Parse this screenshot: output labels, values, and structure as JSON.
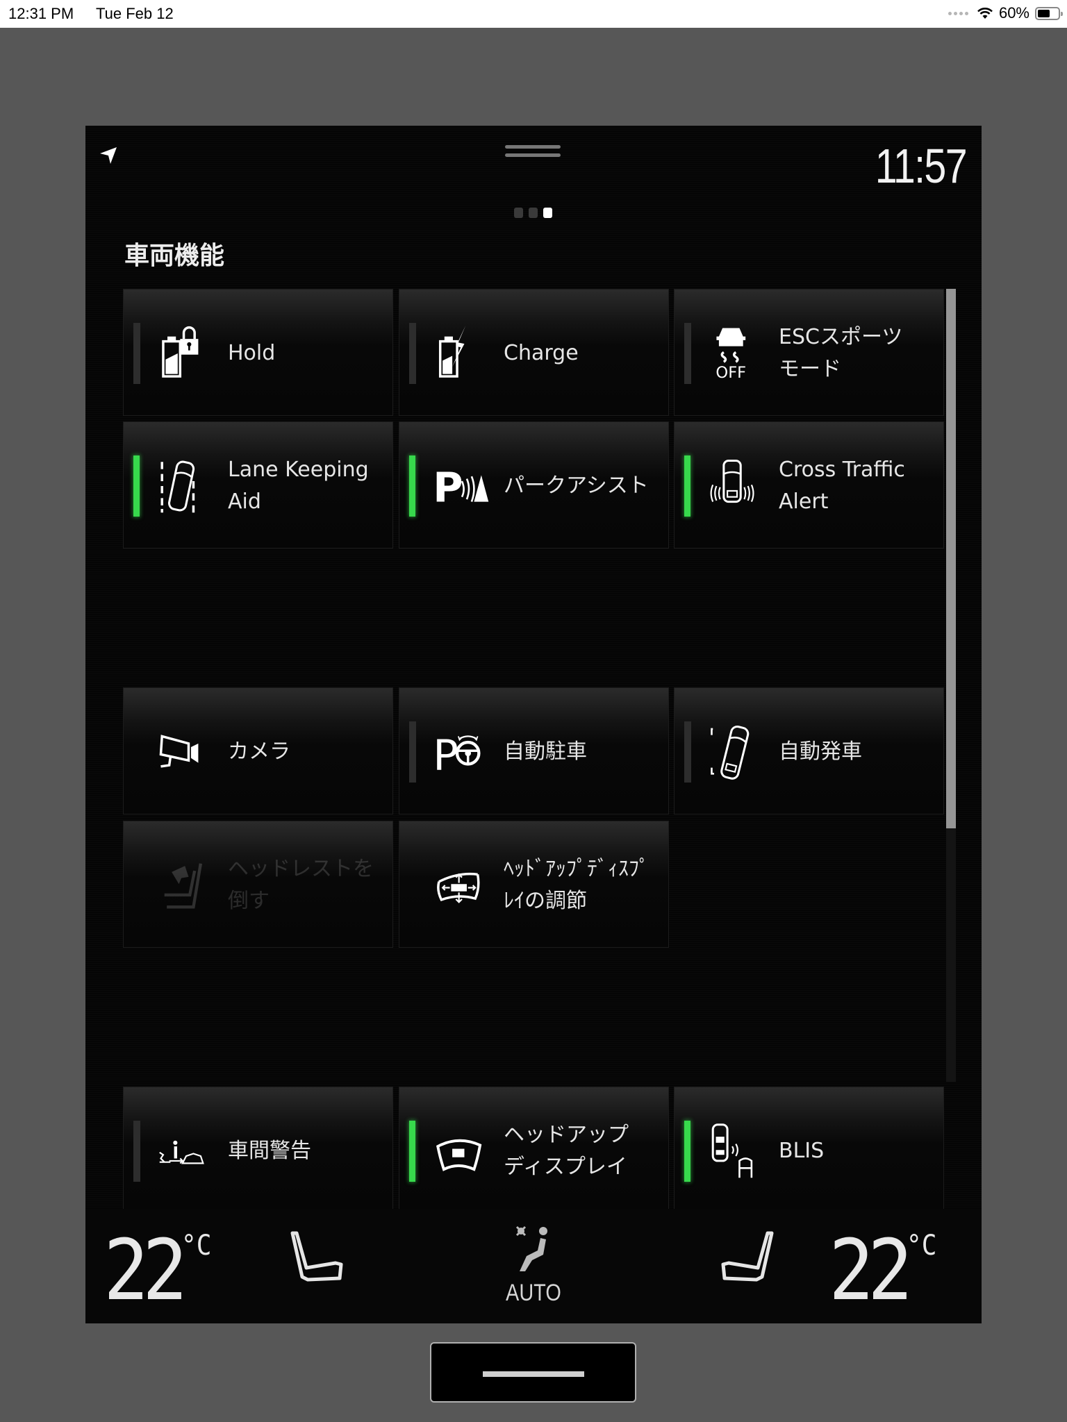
{
  "status_bar": {
    "time": "12:31 PM",
    "date": "Tue Feb 12",
    "battery_percent_label": "60%",
    "battery_level": 0.6,
    "wifi_icon": "wifi-icon"
  },
  "screen": {
    "clock": "11:57",
    "nav_icon": "navigation-arrow-icon",
    "page_indicator": {
      "total": 3,
      "active": 3
    },
    "section_title": "車両機能",
    "scroll_thumb_fraction": 0.68,
    "accent_on_color": "#37d94c",
    "tiles": [
      {
        "id": "hold",
        "lines": [
          "Hold"
        ],
        "icon": "battery-lock-icon",
        "indicator": "off",
        "enabled": true
      },
      {
        "id": "charge",
        "lines": [
          "Charge"
        ],
        "icon": "battery-charge-icon",
        "indicator": "off",
        "enabled": true
      },
      {
        "id": "esc-sport",
        "lines": [
          "ESCスポーツ",
          "モード"
        ],
        "icon": "esc-off-icon",
        "indicator": "off",
        "enabled": true
      },
      {
        "id": "lane-keeping",
        "lines": [
          "Lane Keeping",
          "Aid"
        ],
        "icon": "lane-keeping-icon",
        "indicator": "on",
        "enabled": true
      },
      {
        "id": "park-assist",
        "lines": [
          "パークアシスト"
        ],
        "icon": "park-assist-icon",
        "indicator": "on",
        "enabled": true
      },
      {
        "id": "cross-traffic",
        "lines": [
          "Cross Traffic",
          "Alert"
        ],
        "icon": "cross-traffic-icon",
        "indicator": "on",
        "enabled": true
      },
      {
        "id": "camera",
        "lines": [
          "カメラ"
        ],
        "icon": "camera-icon",
        "indicator": "none",
        "enabled": true
      },
      {
        "id": "auto-park",
        "lines": [
          "自動駐車"
        ],
        "icon": "park-steering-icon",
        "indicator": "off",
        "enabled": true
      },
      {
        "id": "auto-start",
        "lines": [
          "自動発車"
        ],
        "icon": "car-start-icon",
        "indicator": "off",
        "enabled": true
      },
      {
        "id": "headrest",
        "lines": [
          "ヘッドレストを",
          "倒す"
        ],
        "icon": "headrest-fold-icon",
        "indicator": "none",
        "enabled": false
      },
      {
        "id": "hud-adjust",
        "lines": [
          "ﾍｯﾄﾞｱｯﾌﾟﾃﾞｨｽﾌﾟ",
          "ﾚｲの調節"
        ],
        "icon": "hud-adjust-icon",
        "indicator": "none",
        "enabled": true
      },
      {
        "id": "distance-alert",
        "lines": [
          "車間警告"
        ],
        "icon": "distance-alert-icon",
        "indicator": "off",
        "enabled": true
      },
      {
        "id": "hud",
        "lines": [
          "ヘッドアップ",
          "ディスプレイ"
        ],
        "icon": "hud-icon",
        "indicator": "on",
        "enabled": true
      },
      {
        "id": "blis",
        "lines": [
          "BLIS"
        ],
        "icon": "blis-icon",
        "indicator": "on",
        "enabled": true
      }
    ]
  },
  "climate": {
    "left_temp": "22",
    "right_temp": "22",
    "unit": "°C",
    "fan_mode": "AUTO",
    "left_seat_icon": "seat-left-icon",
    "right_seat_icon": "seat-right-icon",
    "fan_icon": "climate-auto-icon"
  }
}
